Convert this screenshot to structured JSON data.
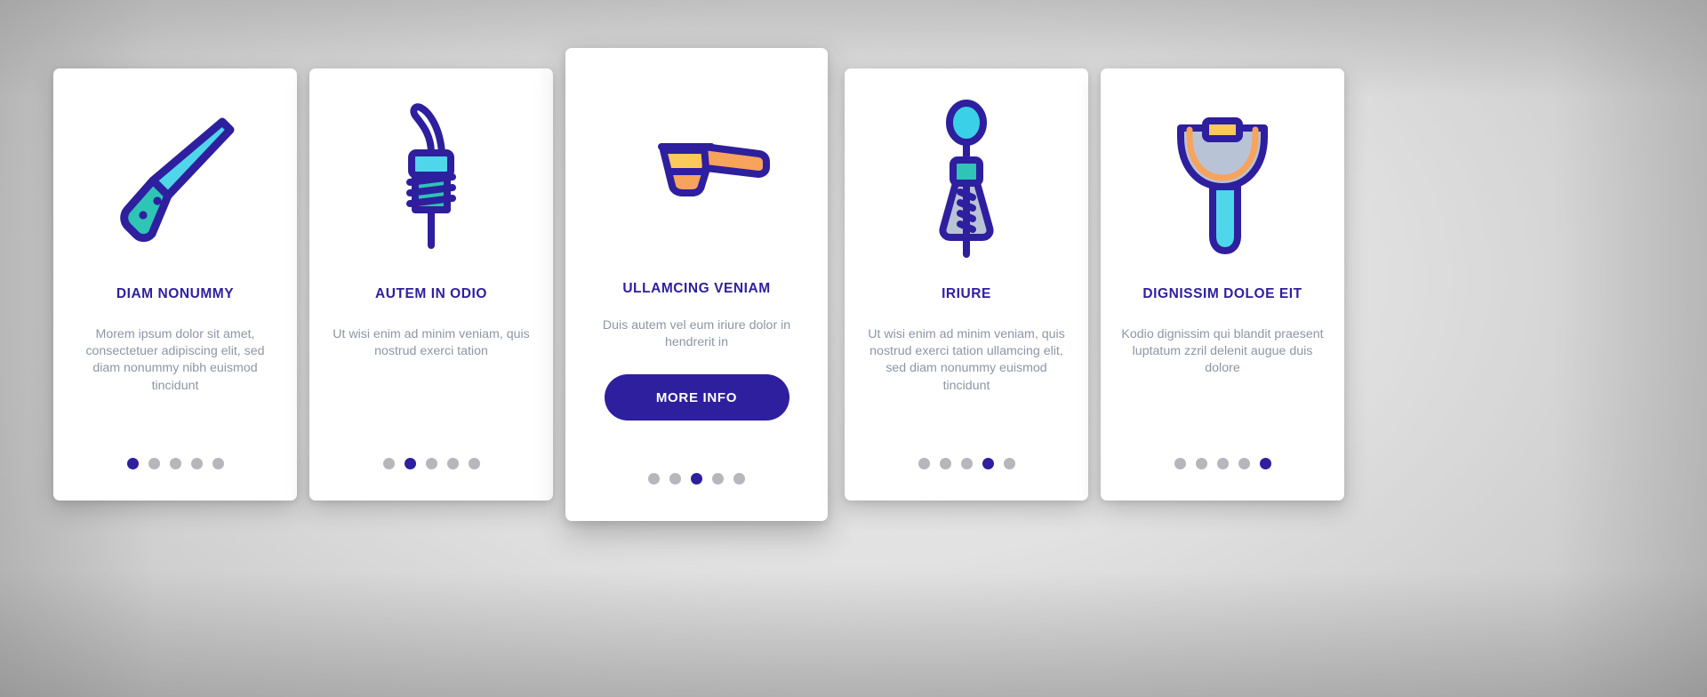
{
  "background": {
    "base_color": "#dcdcdc",
    "edge_color": "#b6b6b6"
  },
  "theme": {
    "primary": "#2e1f9e",
    "body_text": "#8d96a4",
    "card_bg": "#ffffff",
    "dot_inactive": "#b6b6bc",
    "dot_active": "#2e1f9e",
    "accent_cyan": "#3ad1e8",
    "accent_teal": "#2ec4b6",
    "accent_orange": "#f7a35c",
    "accent_yellow": "#fbc85a",
    "accent_grayblue": "#b9c3d6"
  },
  "cards": [
    {
      "id": "card-1",
      "icon": "kitchen-knife-icon",
      "title": "DIAM NONUMMY",
      "body": "Morem ipsum dolor sit amet, consectetuer adipiscing elit, sed diam nonummy nibh euismod tincidunt",
      "dots": [
        true,
        false,
        false,
        false,
        false
      ],
      "has_cta": false,
      "featured": false
    },
    {
      "id": "card-2",
      "icon": "bottle-pourer-icon",
      "title": "AUTEM IN ODIO",
      "body": "Ut wisi enim ad minim veniam, quis nostrud exerci tation",
      "dots": [
        false,
        true,
        false,
        false,
        false
      ],
      "has_cta": false,
      "featured": false
    },
    {
      "id": "card-3",
      "icon": "measuring-scoop-icon",
      "title": "ULLAMCING VENIAM",
      "body": "Duis autem vel eum iriure dolor in hendrerit in",
      "cta_label": "MORE INFO",
      "dots": [
        false,
        false,
        true,
        false,
        false
      ],
      "has_cta": true,
      "featured": true
    },
    {
      "id": "card-4",
      "icon": "whisk-beater-icon",
      "title": "IRIURE",
      "body": "Ut wisi enim ad minim veniam, quis nostrud exerci tation ullamcing elit, sed diam nonummy euismod tincidunt",
      "dots": [
        false,
        false,
        false,
        true,
        false
      ],
      "has_cta": false,
      "featured": false
    },
    {
      "id": "card-5",
      "icon": "vegetable-peeler-icon",
      "title": "DIGNISSIM DOLOE EIT",
      "body": "Kodio dignissim qui blandit praesent luptatum zzril delenit augue duis dolore",
      "dots": [
        false,
        false,
        false,
        false,
        true
      ],
      "has_cta": false,
      "featured": false
    }
  ]
}
